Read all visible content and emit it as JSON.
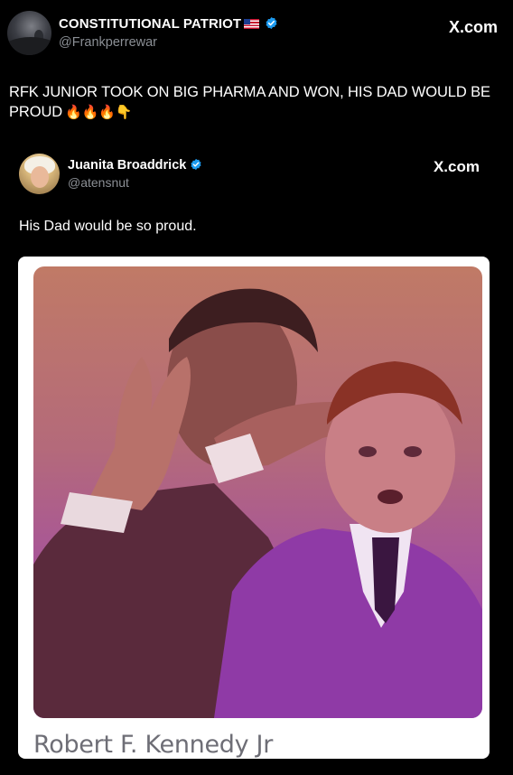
{
  "outer_tweet": {
    "display_name": "CONSTITUTIONAL PATRIOT",
    "handle": "@Frankperrewar",
    "text": "RFK JUNIOR TOOK ON BIG PHARMA AND WON, HIS DAD WOULD BE PROUD",
    "emojis": "🔥🔥🔥👇",
    "source": "X.com",
    "flag_icon": "us-flag-icon",
    "verified_icon": "verified-badge-icon"
  },
  "quoted_tweet": {
    "display_name": "Juanita Broaddrick",
    "handle": "@atensnut",
    "text": "His Dad would be so proud.",
    "source": "X.com",
    "verified_icon": "verified-badge-icon"
  },
  "media": {
    "caption": "Robert F. Kennedy Jr"
  },
  "colors": {
    "background": "#000000",
    "text": "#ffffff",
    "handle": "#8b8f95",
    "verified": "#1d9bf0",
    "photo_top": "#c07a66",
    "photo_bottom": "#9130b8"
  }
}
